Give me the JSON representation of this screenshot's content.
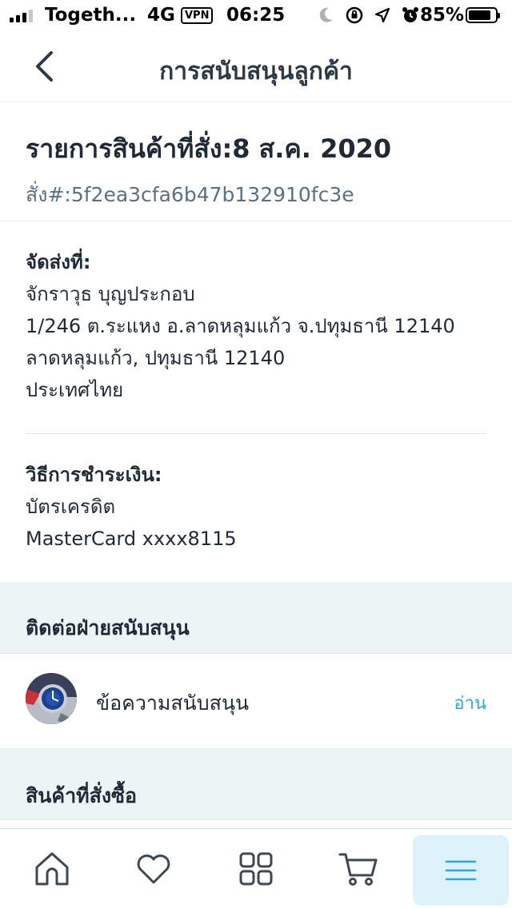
{
  "status_bar": {
    "carrier": "Togeth...",
    "network": "4G",
    "vpn": "VPN",
    "time": "06:25",
    "battery_percent": "85%",
    "battery_level": 0.85,
    "icons": [
      "moon-icon",
      "orientation-lock-icon",
      "location-arrow-icon",
      "alarm-icon"
    ]
  },
  "header": {
    "title": "การสนับสนุนลูกค้า",
    "back_icon": "chevron-left-icon"
  },
  "order": {
    "title": "รายการสินค้าที่สั่ง:8 ส.ค. 2020",
    "number": "สั่ง#:5f2ea3cfa6b47b132910fc3e"
  },
  "shipping": {
    "label": "จัดส่งที่:",
    "lines": [
      "จักราวุธ บุญประกอบ",
      "1/246 ต.ระแหง อ.ลาดหลุมแก้ว จ.ปทุมธานี 12140",
      "ลาดหลุมแก้ว, ปทุมธานี 12140",
      "ประเทศไทย"
    ]
  },
  "payment": {
    "label": "วิธีการชำระเงิน:",
    "lines": [
      "บัตรเครดิต",
      "MasterCard xxxx8115"
    ]
  },
  "contact_section": {
    "title": "ติดต่อฝ่ายสนับสนุน",
    "support_label": "ข้อความสนับสนุน",
    "read_link": "อ่าน"
  },
  "products_section": {
    "title": "สินค้าที่สั่งซื้อ"
  },
  "bottom_nav": {
    "items": [
      "home-icon",
      "heart-icon",
      "grid-icon",
      "cart-icon",
      "menu-icon"
    ],
    "active": "menu-icon"
  },
  "colors": {
    "accent": "#2aa8d8",
    "active_tab_bg": "#dcf1fa",
    "section_bg": "#eef3f6",
    "text": "#1f2a36",
    "muted": "#5b7080"
  }
}
